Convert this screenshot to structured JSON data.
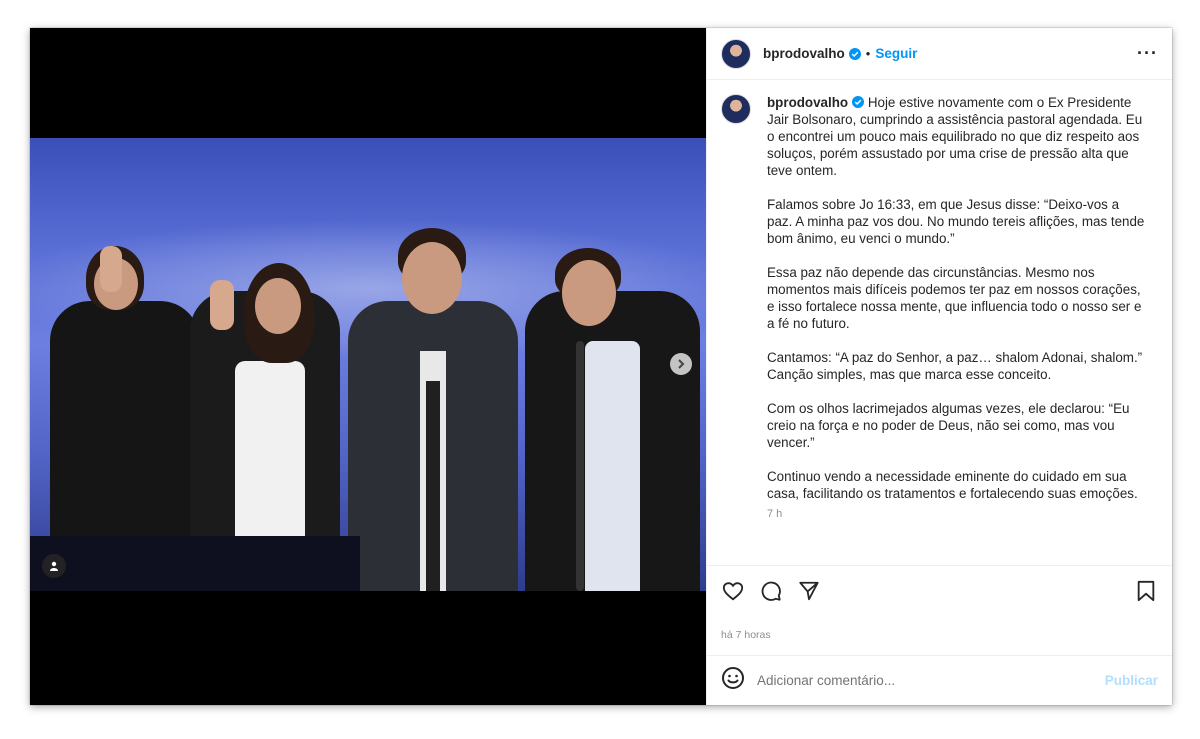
{
  "post": {
    "username": "bprodovalho",
    "follow_label": "Seguir",
    "separator": "•",
    "more_label": "···",
    "caption_paragraphs": [
      "Hoje estive novamente com o Ex Presidente Jair Bolsonaro, cumprindo a assistência pastoral agendada. Eu o encontrei um pouco mais equilibrado no que diz respeito aos soluços, porém assustado por uma crise de pressão alta que teve ontem.",
      "Falamos sobre Jo 16:33, em que Jesus disse: “Deixo-vos a paz. A minha paz vos dou. No mundo tereis aflições, mas tende bom ânimo, eu venci o mundo.”",
      "Essa paz não depende das circunstâncias. Mesmo nos momentos mais difíceis podemos ter paz em nossos corações, e isso fortalece nossa mente, que influencia todo o nosso ser e a fé no futuro.",
      "Cantamos: “A paz do Senhor, a paz… shalom Adonai, shalom.” Canção simples, mas que marca esse conceito.",
      "Com os olhos lacrimejados algumas vezes, ele declarou: “Eu creio na força e no poder de Deus, não sei como, mas vou vencer.”",
      "Continuo vendo a necessidade eminente do cuidado em sua casa, facilitando os tratamentos e fortalecendo suas emoções."
    ],
    "caption_time": "7 h",
    "post_time": "há 7 horas"
  },
  "comment_box": {
    "placeholder": "Adicionar comentário...",
    "publish_label": "Publicar"
  },
  "icons": {
    "like": "heart-icon",
    "comment": "comment-icon",
    "share": "send-icon",
    "save": "bookmark-icon",
    "emoji": "emoji-icon",
    "tag": "user-tag-icon",
    "next": "chevron-right-icon"
  },
  "colors": {
    "accent": "#0095f6",
    "publish_disabled": "#b2dffc",
    "verified": "#0095f6"
  }
}
